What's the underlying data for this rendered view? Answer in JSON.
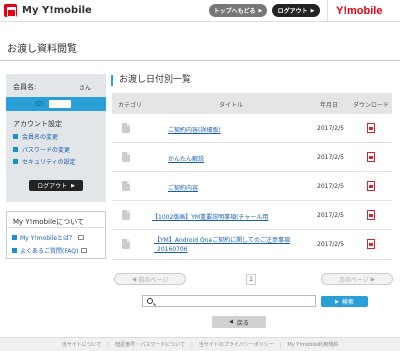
{
  "header": {
    "brand": "My Y!mobile",
    "top_button": "トップへもどる",
    "logout_button": "ログアウト",
    "logo": "Y!mobile"
  },
  "page_title": "お渡し資料閲覧",
  "sidebar": {
    "member_label": "会員名:",
    "member_suffix": "さん",
    "id_prefix": "ID:",
    "account_heading": "アカウント設定",
    "links": [
      "会員名の変更",
      "パスワードの変更",
      "セキュリティの設定"
    ],
    "logout_button": "ログアウト",
    "about_title": "My Y!mobileについて",
    "about_links": [
      "My Y!mobileとは？",
      "よくあるご質問(FAQ)"
    ]
  },
  "list": {
    "title": "お渡し日付別一覧",
    "columns": [
      "カテゴリ",
      "タイトル",
      "年月日",
      "ダウンロード"
    ],
    "rows": [
      {
        "title": "ご契約内容(詳細版)",
        "date": "2017/2/5"
      },
      {
        "title": "かんたん解説",
        "date": "2017/2/5"
      },
      {
        "title": "ご契約内容",
        "date": "2017/2/5"
      },
      {
        "title": "【1002版画】YM重要説明事項(チャール用",
        "date": "2017/2/5"
      },
      {
        "title": "【YM】Android Oneご契約に関してのご注意事項_20160706",
        "date": "2017/2/5"
      }
    ]
  },
  "pagination": {
    "prev": "前のページ",
    "current": "1",
    "next": "次のページ"
  },
  "search": {
    "placeholder": "",
    "button": "検索"
  },
  "back_button": "戻る",
  "footer": {
    "links": [
      "当サイトについて",
      "暗証番号・パスワードについて",
      "当サイトのプライバシーポリシー",
      "My Y!mobile利用規約"
    ]
  }
}
